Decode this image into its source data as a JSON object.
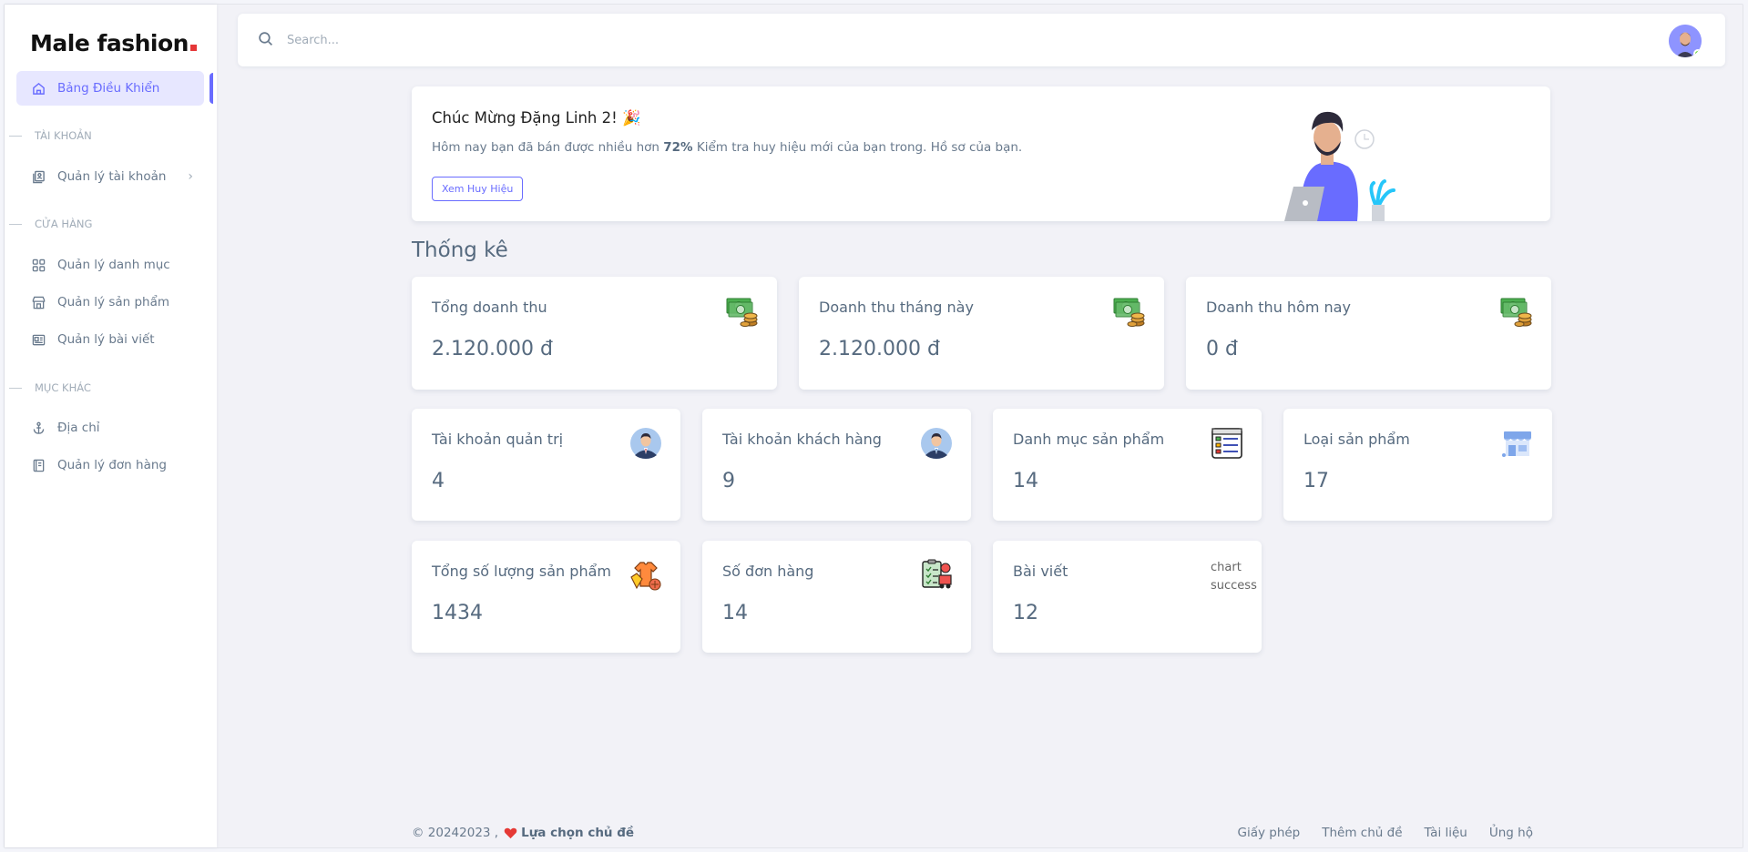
{
  "brand": {
    "name": "Male fashion"
  },
  "sidebar": {
    "dashboard": "Bảng Điều Khiển",
    "sections": [
      {
        "header": "TÀI KHOẢN",
        "items": [
          "Quản lý tài khoản"
        ]
      },
      {
        "header": "CỬA HÀNG",
        "items": [
          "Quản lý danh mục",
          "Quản lý sản phẩm",
          "Quản lý bài viết"
        ]
      },
      {
        "header": "MỤC KHÁC",
        "items": [
          "Địa chỉ",
          "Quản lý đơn hàng"
        ]
      }
    ]
  },
  "search": {
    "placeholder": "Search..."
  },
  "welcome": {
    "title": "Chúc Mừng Đặng Linh 2! 🎉",
    "text_before": "Hôm nay bạn đã bán được nhiều hơn ",
    "percent": "72%",
    "text_after": " Kiểm tra huy hiệu mới của bạn trong. Hồ sơ của bạn.",
    "button": "Xem Huy Hiệu"
  },
  "stats_title": "Thống kê",
  "stats_row1": [
    {
      "label": "Tổng doanh thu",
      "value": "2.120.000 đ",
      "icon": "money-icon"
    },
    {
      "label": "Doanh thu tháng này",
      "value": "2.120.000 đ",
      "icon": "money-icon"
    },
    {
      "label": "Doanh thu hôm nay",
      "value": "0 đ",
      "icon": "money-icon"
    }
  ],
  "stats_row2": [
    {
      "label": "Tài khoản quản trị",
      "value": "4",
      "icon": "admin-user-icon"
    },
    {
      "label": "Tài khoản khách hàng",
      "value": "9",
      "icon": "customer-user-icon"
    },
    {
      "label": "Danh mục sản phẩm",
      "value": "14",
      "icon": "checklist-icon"
    },
    {
      "label": "Loại sản phẩm",
      "value": "17",
      "icon": "store-icon"
    }
  ],
  "stats_row3": [
    {
      "label": "Tổng số lượng sản phẩm",
      "value": "1434",
      "icon": "clothes-icon"
    },
    {
      "label": "Số đơn hàng",
      "value": "14",
      "icon": "order-icon"
    },
    {
      "label": "Bài viết",
      "value": "12",
      "broken_alt": "chart success"
    }
  ],
  "footer": {
    "copyright": "© 20242023 ,",
    "brand": "Lựa chọn chủ đề",
    "links": [
      "Giấy phép",
      "Thêm chủ đề",
      "Tài liệu",
      "Ủng hộ"
    ]
  },
  "colors": {
    "primary": "#696cff",
    "text": "#566a7f",
    "muted": "#a1acb8",
    "background": "#f4f5fa",
    "brand_dot": "#e53637"
  }
}
